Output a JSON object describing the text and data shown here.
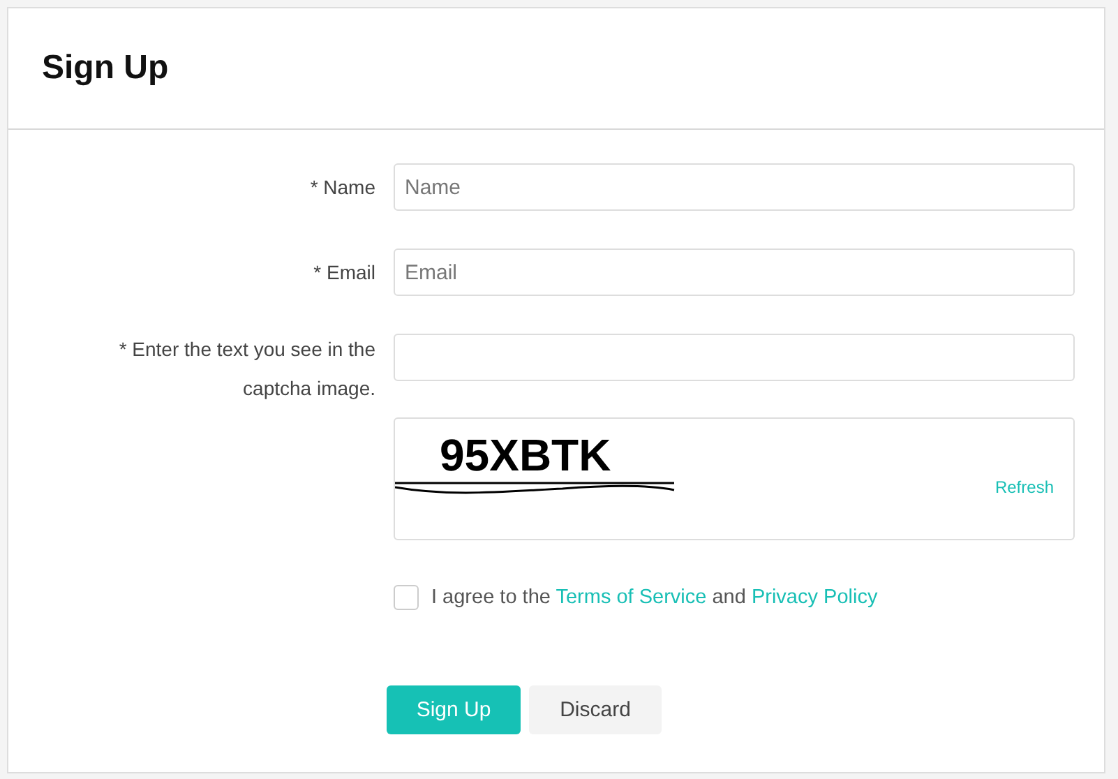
{
  "title": "Sign Up",
  "fields": [
    {
      "label": "* Name",
      "placeholder": "Name"
    },
    {
      "label": "* Email",
      "placeholder": "Email"
    },
    {
      "label": "* Enter the text you see in the captcha image."
    }
  ],
  "captcha": {
    "text": "95XBTK",
    "refresh": "Refresh"
  },
  "agreement": {
    "checked": false,
    "parts": [
      {
        "kind": "text",
        "text": "I agree to the "
      },
      {
        "kind": "link",
        "text": "Terms of Service"
      },
      {
        "kind": "text",
        "text": " and "
      },
      {
        "kind": "link",
        "text": "Privacy Policy"
      }
    ]
  },
  "buttons": [
    {
      "label": "Sign Up",
      "kind": "primary"
    },
    {
      "label": "Discard",
      "kind": "secondary"
    }
  ]
}
